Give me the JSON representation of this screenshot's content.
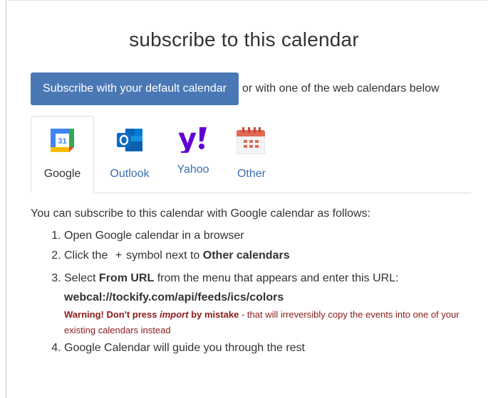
{
  "dialog": {
    "title": "subscribe to this calendar",
    "subscribe_button": "Subscribe with your default calendar",
    "or_text": "or with one of the web calendars below"
  },
  "tabs": [
    {
      "label": "Google",
      "icon": "google-calendar-icon",
      "active": true
    },
    {
      "label": "Outlook",
      "icon": "outlook-icon",
      "active": false
    },
    {
      "label": "Yahoo",
      "icon": "yahoo-icon",
      "active": false
    },
    {
      "label": "Other",
      "icon": "calendar-icon",
      "active": false
    }
  ],
  "content": {
    "intro": "You can subscribe to this calendar with Google calendar as follows:",
    "step1": "Open Google calendar in a browser",
    "step2_pre": "Click the",
    "step2_plus": "+",
    "step2_mid": "symbol next to",
    "step2_bold": "Other calendars",
    "step3_pre": "Select",
    "step3_bold1": "From URL",
    "step3_mid": "from the menu that appears and enter this URL:",
    "step3_url": "webcal://tockify.com/api/feeds/ics/colors",
    "warning_bold1": "Warning! Don't press",
    "warning_italic": "import",
    "warning_bold2": "by mistake",
    "warning_rest": "- that will irreversibly copy the events into one of your existing calendars instead",
    "step4": "Google Calendar will guide you through the rest"
  },
  "colors": {
    "button_bg": "#4a78b5",
    "link": "#3a6fb0",
    "warning": "#8b1a1a"
  }
}
